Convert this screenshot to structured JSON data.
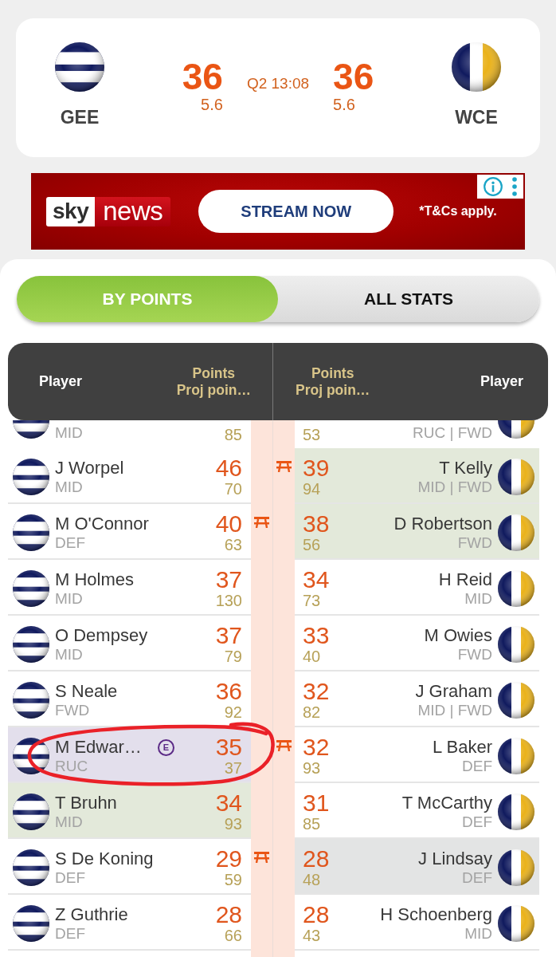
{
  "scoreboard": {
    "home": {
      "team": "GEE",
      "kind": "hoops",
      "score": "36",
      "breakdown": "5.6"
    },
    "clock": "Q2 13:08",
    "away": {
      "team": "WCE",
      "kind": "vertical_stripes",
      "score": "36",
      "breakdown": "5.6"
    }
  },
  "ad": {
    "logo": [
      "sky",
      "news"
    ],
    "button": "STREAM NOW",
    "disclaimer": "*T&Cs apply."
  },
  "tabs": [
    {
      "label": "BY POINTS",
      "selected": true
    },
    {
      "label": "ALL STATS",
      "selected": false
    }
  ],
  "table": {
    "columns": [
      {
        "label": "Player"
      },
      {
        "label": "Points",
        "sublabel": "Proj poin…"
      },
      {
        "label": "Points",
        "sublabel": "Proj poin…"
      },
      {
        "label": "Player"
      }
    ],
    "rows": [
      {
        "kind": "clipped",
        "left": {
          "position": "MID",
          "projected": "85",
          "on_bench": false,
          "circled": false,
          "color": "#ffffff"
        },
        "right": {
          "position": "RUC | FWD",
          "projected": "53",
          "on_bench": false,
          "circled": false,
          "color": "#ffffff"
        }
      },
      {
        "kind": "full",
        "left": {
          "name": "J Worpel",
          "position": "MID",
          "points": "46",
          "projected": "70",
          "on_bench": false,
          "circled": false,
          "color": "#ffffff"
        },
        "right": {
          "name": "T Kelly",
          "position": "MID | FWD",
          "points": "39",
          "projected": "94",
          "on_bench": true,
          "circled": false,
          "color": "#e3e9da"
        }
      },
      {
        "kind": "full",
        "left": {
          "name": "M O'Connor",
          "position": "DEF",
          "points": "40",
          "projected": "63",
          "on_bench": true,
          "circled": false,
          "color": "#ffffff"
        },
        "right": {
          "name": "D Robertson",
          "position": "FWD",
          "points": "38",
          "projected": "56",
          "on_bench": false,
          "circled": false,
          "color": "#e3e9da"
        }
      },
      {
        "kind": "full",
        "left": {
          "name": "M Holmes",
          "position": "MID",
          "points": "37",
          "projected": "130",
          "on_bench": false,
          "circled": false,
          "color": "#ffffff"
        },
        "right": {
          "name": "H Reid",
          "position": "MID",
          "points": "34",
          "projected": "73",
          "on_bench": false,
          "circled": false,
          "color": "#ffffff"
        }
      },
      {
        "kind": "full",
        "left": {
          "name": "O Dempsey",
          "position": "MID",
          "points": "37",
          "projected": "79",
          "on_bench": false,
          "circled": false,
          "color": "#ffffff"
        },
        "right": {
          "name": "M Owies",
          "position": "FWD",
          "points": "33",
          "projected": "40",
          "on_bench": false,
          "circled": false,
          "color": "#ffffff"
        }
      },
      {
        "kind": "full",
        "left": {
          "name": "S Neale",
          "position": "FWD",
          "points": "36",
          "projected": "92",
          "on_bench": false,
          "circled": false,
          "color": "#ffffff"
        },
        "right": {
          "name": "J Graham",
          "position": "MID | FWD",
          "points": "32",
          "projected": "82",
          "on_bench": false,
          "circled": false,
          "color": "#ffffff"
        }
      },
      {
        "kind": "full",
        "left": {
          "name": "M Edwar…",
          "badge": "E",
          "position": "RUC",
          "points": "35",
          "projected": "37",
          "on_bench": false,
          "circled": true,
          "color": "#e3dfec"
        },
        "right": {
          "name": "L Baker",
          "position": "DEF",
          "points": "32",
          "projected": "93",
          "on_bench": true,
          "circled": false,
          "color": "#ffffff"
        }
      },
      {
        "kind": "full",
        "left": {
          "name": "T Bruhn",
          "position": "MID",
          "points": "34",
          "projected": "93",
          "on_bench": false,
          "circled": false,
          "color": "#e3e9da"
        },
        "right": {
          "name": "T McCarthy",
          "position": "DEF",
          "points": "31",
          "projected": "85",
          "on_bench": false,
          "circled": false,
          "color": "#ffffff"
        }
      },
      {
        "kind": "full",
        "left": {
          "name": "S De Koning",
          "position": "DEF",
          "points": "29",
          "projected": "59",
          "on_bench": true,
          "circled": false,
          "color": "#ffffff"
        },
        "right": {
          "name": "J Lindsay",
          "position": "DEF",
          "points": "28",
          "projected": "48",
          "on_bench": false,
          "circled": false,
          "color": "#e3e4e4"
        }
      },
      {
        "kind": "full",
        "left": {
          "name": "Z Guthrie",
          "position": "DEF",
          "points": "28",
          "projected": "66",
          "on_bench": false,
          "circled": false,
          "color": "#ffffff"
        },
        "right": {
          "name": "H Schoenberg",
          "position": "MID",
          "points": "28",
          "projected": "43",
          "on_bench": false,
          "circled": false,
          "color": "#ffffff"
        }
      }
    ]
  }
}
